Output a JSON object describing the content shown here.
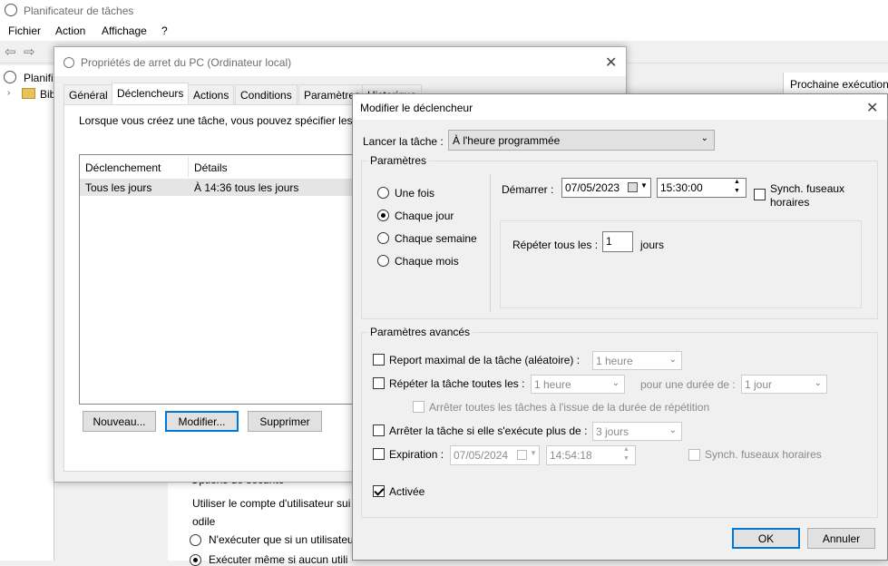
{
  "main": {
    "title": "Planificateur de tâches",
    "menu": [
      "Fichier",
      "Action",
      "Affichage",
      "?"
    ],
    "tree_item": "Planifi",
    "tree_sub": "Bib",
    "right_header": "Prochaine exécution",
    "under": {
      "section": "Options de sécurité",
      "account_label": "Utiliser le compte d'utilisateur sui",
      "user": "odile",
      "opt1": "N'exécuter que si un utilisateur",
      "opt2": "Exécuter même si aucun utili"
    }
  },
  "props": {
    "title": "Propriétés de arret du PC (Ordinateur local)",
    "tabs": [
      "Général",
      "Déclencheurs",
      "Actions",
      "Conditions",
      "Paramètres",
      "Historique"
    ],
    "intro": "Lorsque vous créez une tâche, vous pouvez spécifier les c",
    "columns": [
      "Déclenchement",
      "Détails"
    ],
    "rows": [
      {
        "trigger": "Tous les jours",
        "details": "À 14:36 tous les jours"
      }
    ],
    "buttons": {
      "new": "Nouveau...",
      "edit": "Modifier...",
      "delete": "Supprimer"
    }
  },
  "modify": {
    "title": "Modifier le déclencheur",
    "launch_label": "Lancer la tâche :",
    "launch_value": "À l'heure programmée",
    "params_label": "Paramètres",
    "radios": [
      "Une fois",
      "Chaque jour",
      "Chaque semaine",
      "Chaque mois"
    ],
    "selected": 1,
    "start_label": "Démarrer :",
    "start_date": "07/05/2023",
    "start_time": "15:30:00",
    "sync_label_1": "Synch. fuseaux",
    "sync_label_2": "horaires",
    "repeat_label": "Répéter tous les :",
    "repeat_value": "1",
    "repeat_unit": "jours",
    "advanced_label": "Paramètres avancés",
    "delay_label": "Report maximal de la tâche (aléatoire) :",
    "delay_value": "1 heure",
    "repeat_task_label": "Répéter la tâche toutes les :",
    "repeat_task_value": "1 heure",
    "duration_label": "pour une durée de :",
    "duration_value": "1 jour",
    "stop_all_label": "Arrêter toutes les tâches à l'issue de la durée de répétition",
    "stop_label": "Arrêter la tâche si elle s'exécute plus de :",
    "stop_value": "3 jours",
    "expire_label": "Expiration :",
    "expire_date": "07/05/2024",
    "expire_time": "14:54:18",
    "expire_sync": "Synch. fuseaux horaires",
    "enabled_label": "Activée",
    "ok": "OK",
    "cancel": "Annuler"
  }
}
